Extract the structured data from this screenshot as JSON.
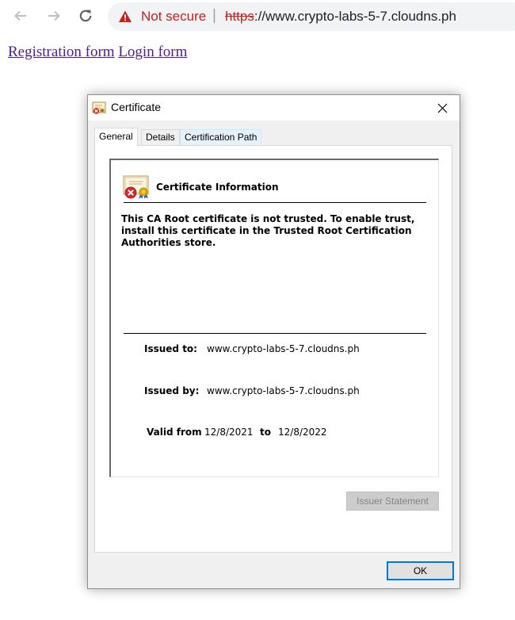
{
  "browser": {
    "security_label": "Not secure",
    "separator": "|",
    "url_scheme": "https",
    "url_rest": "://www.crypto-labs-5-7.cloudns.ph",
    "icons": [
      "back-arrow-icon",
      "forward-arrow-icon",
      "reload-icon",
      "warning-triangle-icon"
    ],
    "colors": {
      "warning": "#c5221f",
      "omnibox_bg": "#f1f3f4"
    }
  },
  "page": {
    "links": [
      "Registration form",
      "Login form"
    ],
    "link_color": "#551a8b"
  },
  "dialog": {
    "title": "Certificate",
    "tabs": [
      {
        "label": "General",
        "active": true
      },
      {
        "label": "Details",
        "active": false
      },
      {
        "label": "Certification Path",
        "active": false
      }
    ],
    "info": {
      "heading": "Certificate Information",
      "message": "This CA Root certificate is not trusted. To enable trust, install this certificate in the Trusted Root Certification Authorities store.",
      "issued_to_label": "Issued to:",
      "issued_to_value": "www.crypto-labs-5-7.cloudns.ph",
      "issued_by_label": "Issued by:",
      "issued_by_value": "www.crypto-labs-5-7.cloudns.ph",
      "valid_from_label": "Valid from",
      "valid_from_value": "12/8/2021",
      "valid_to_label": "to",
      "valid_to_value": "12/8/2022"
    },
    "issuer_statement_label": "Issuer Statement",
    "issuer_statement_enabled": false,
    "ok_label": "OK",
    "icons": [
      "certificate-icon",
      "close-icon",
      "certificate-error-icon"
    ],
    "colors": {
      "focus_border": "#0078d7",
      "dialog_bg": "#f0f0f0"
    }
  }
}
